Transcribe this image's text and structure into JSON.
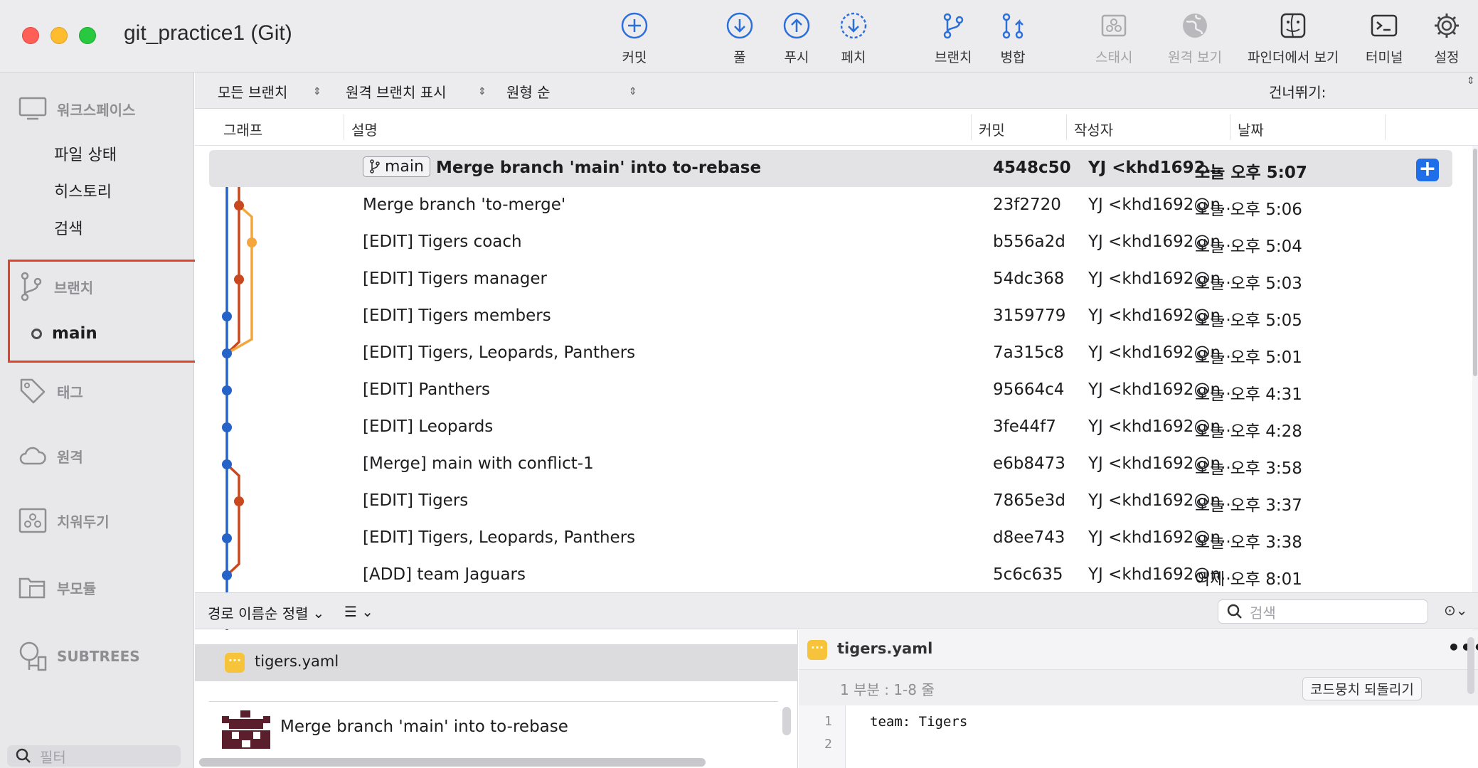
{
  "window": {
    "title": "git_practice1 (Git)"
  },
  "toolbar": {
    "commit": "커밋",
    "pull": "풀",
    "push": "푸시",
    "fetch": "페치",
    "branch": "브랜치",
    "merge": "병합",
    "stash": "스태시",
    "remote": "원격 보기",
    "finder": "파인더에서 보기",
    "terminal": "터미널",
    "settings": "설정"
  },
  "sidebar": {
    "workspace": "워크스페이스",
    "workspace_items": [
      "파일 상태",
      "히스토리",
      "검색"
    ],
    "branches": "브랜치",
    "current_branch": "main",
    "tags": "태그",
    "remotes": "원격",
    "stashes": "치워두기",
    "submodules": "부모듈",
    "subtrees": "SUBTREES",
    "filter_placeholder": "필터"
  },
  "filterbar": {
    "branches": "모든 브랜치",
    "remote": "원격 브랜치 표시",
    "order": "원형 순",
    "jump": "건너뛰기:"
  },
  "columns": {
    "graph": "그래프",
    "description": "설명",
    "commit": "커밋",
    "author": "작성자",
    "date": "날짜"
  },
  "commits": [
    {
      "desc": "Merge branch 'main' into to-rebase",
      "hash": "4548c50",
      "author": "YJ <khd1692@...",
      "date": "오늘 오후 5:07",
      "tag": "main"
    },
    {
      "desc": "Merge branch 'to-merge'",
      "hash": "23f2720",
      "author": "YJ <khd1692@n...",
      "date": "오늘 오후 5:06"
    },
    {
      "desc": "[EDIT] Tigers coach",
      "hash": "b556a2d",
      "author": "YJ <khd1692@n...",
      "date": "오늘 오후 5:04"
    },
    {
      "desc": "[EDIT] Tigers manager",
      "hash": "54dc368",
      "author": "YJ <khd1692@n...",
      "date": "오늘 오후 5:03"
    },
    {
      "desc": "[EDIT] Tigers members",
      "hash": "3159779",
      "author": "YJ <khd1692@n...",
      "date": "오늘 오후 5:05"
    },
    {
      "desc": "[EDIT] Tigers, Leopards, Panthers",
      "hash": "7a315c8",
      "author": "YJ <khd1692@n...",
      "date": "오늘 오후 5:01"
    },
    {
      "desc": "[EDIT] Panthers",
      "hash": "95664c4",
      "author": "YJ <khd1692@n...",
      "date": "오늘 오후 4:31"
    },
    {
      "desc": "[EDIT] Leopards",
      "hash": "3fe44f7",
      "author": "YJ <khd1692@n...",
      "date": "오늘 오후 4:28"
    },
    {
      "desc": "[Merge] main with conflict-1",
      "hash": "e6b8473",
      "author": "YJ <khd1692@n...",
      "date": "오늘 오후 3:58"
    },
    {
      "desc": "[EDIT] Tigers",
      "hash": "7865e3d",
      "author": "YJ <khd1692@n...",
      "date": "오늘 오후 3:37"
    },
    {
      "desc": "[EDIT] Tigers, Leopards, Panthers",
      "hash": "d8ee743",
      "author": "YJ <khd1692@n...",
      "date": "오늘 오후 3:38"
    },
    {
      "desc": "[ADD] team Jaguars",
      "hash": "5c6c635",
      "author": "YJ <khd1692@n...",
      "date": "어제 오후 8:01"
    }
  ],
  "bottom": {
    "sort_label": "경로 이름순 정렬",
    "search_placeholder": "검색",
    "file": "tigers.yaml",
    "commit_message": "Merge branch 'main' into to-rebase"
  },
  "diff": {
    "file": "tigers.yaml",
    "hunk": "1 부분 : 1-8 줄",
    "revert": "코드뭉치 되돌리기",
    "line_numbers": [
      "1",
      "2"
    ],
    "lines": [
      "team: Tigers",
      ""
    ]
  },
  "colors": {
    "branch_blue": "#2563c9",
    "branch_red": "#c9481f",
    "branch_orange": "#f4a53b",
    "accent": "#1f6feb",
    "highlight": "#e0452a"
  }
}
